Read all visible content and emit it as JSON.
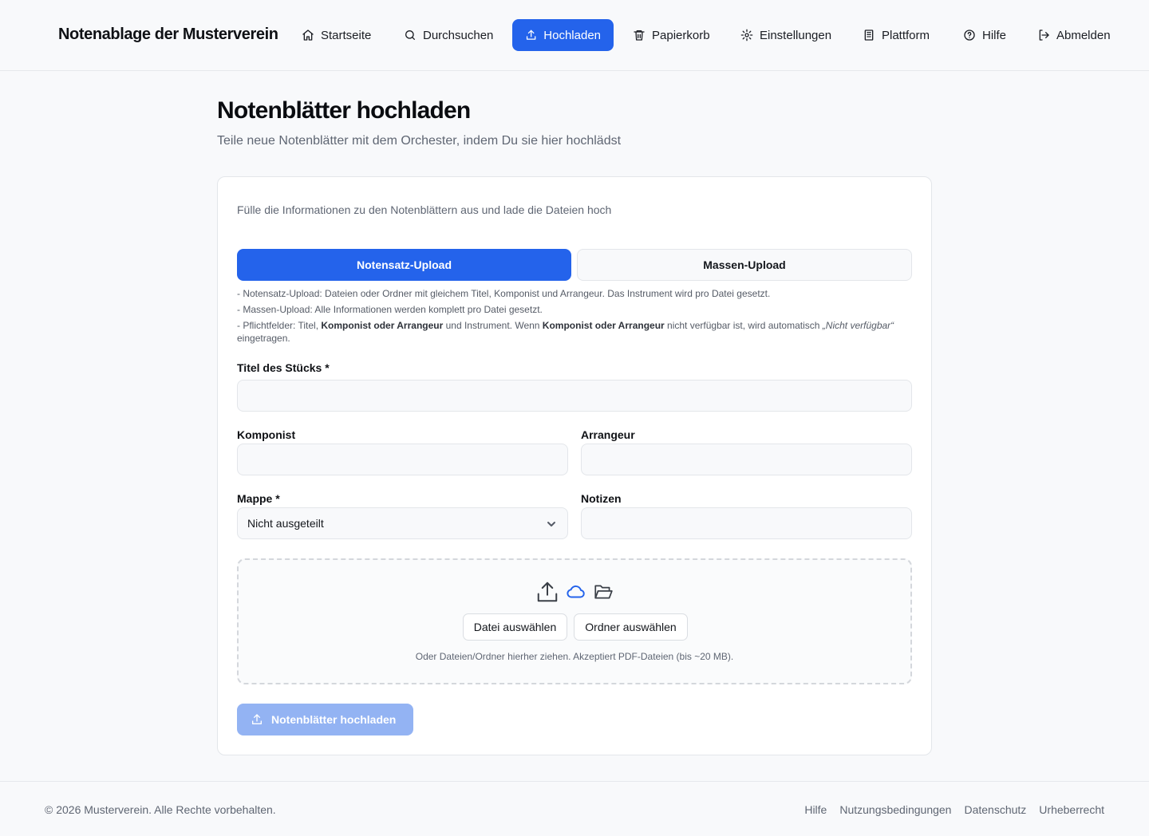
{
  "header": {
    "brand": "Notenablage der Musterverein",
    "nav": [
      {
        "label": "Startseite",
        "icon": "home-icon"
      },
      {
        "label": "Durchsuchen",
        "icon": "search-icon"
      },
      {
        "label": "Hochladen",
        "icon": "upload-icon",
        "active": true
      },
      {
        "label": "Papierkorb",
        "icon": "trash-icon"
      },
      {
        "label": "Einstellungen",
        "icon": "gear-icon"
      },
      {
        "label": "Plattform",
        "icon": "building-icon"
      },
      {
        "label": "Hilfe",
        "icon": "help-circle-icon"
      },
      {
        "label": "Abmelden",
        "icon": "logout-icon"
      }
    ]
  },
  "page": {
    "title": "Notenblätter hochladen",
    "subtitle": "Teile neue Notenblätter mit dem Orchester, indem Du sie hier hochlädst"
  },
  "card": {
    "description": "Fülle die Informationen zu den Notenblättern aus und lade die Dateien hoch",
    "tabs": [
      {
        "label": "Notensatz-Upload",
        "active": true
      },
      {
        "label": "Massen-Upload",
        "active": false
      }
    ],
    "notes": {
      "line1": "- Notensatz-Upload: Dateien oder Ordner mit gleichem Titel, Komponist und Arrangeur. Das Instrument wird pro Datei gesetzt.",
      "line2": "- Massen-Upload: Alle Informationen werden komplett pro Datei gesetzt.",
      "line3_a": "- Pflichtfelder: Titel, ",
      "line3_b": "Komponist oder Arrangeur",
      "line3_c": " und Instrument. Wenn ",
      "line3_d": "Komponist oder Arrangeur",
      "line3_e": " nicht verfügbar ist, wird automatisch ",
      "line3_f": "„Nicht verfügbar“",
      "line3_g": " eingetragen."
    },
    "fields": {
      "title_label": "Titel des Stücks *",
      "title_value": "",
      "composer_label": "Komponist",
      "composer_value": "",
      "arranger_label": "Arrangeur",
      "arranger_value": "",
      "folder_label": "Mappe *",
      "folder_value": "Nicht ausgeteilt",
      "notes_label": "Notizen",
      "notes_value": ""
    },
    "dropzone": {
      "select_file": "Datei auswählen",
      "select_folder": "Ordner auswählen",
      "hint": "Oder Dateien/Ordner hierher ziehen. Akzeptiert PDF-Dateien (bis ~20 MB)."
    },
    "submit_label": "Notenblätter hochladen"
  },
  "footer": {
    "copyright": "© 2026 Musterverein. Alle Rechte vorbehalten.",
    "links": [
      "Hilfe",
      "Nutzungsbedingungen",
      "Datenschutz",
      "Urheberrecht"
    ]
  },
  "colors": {
    "accent": "#2463eb",
    "accent_disabled": "#93b3f3",
    "background": "#f8f9fb",
    "muted_text": "#5f6673"
  }
}
